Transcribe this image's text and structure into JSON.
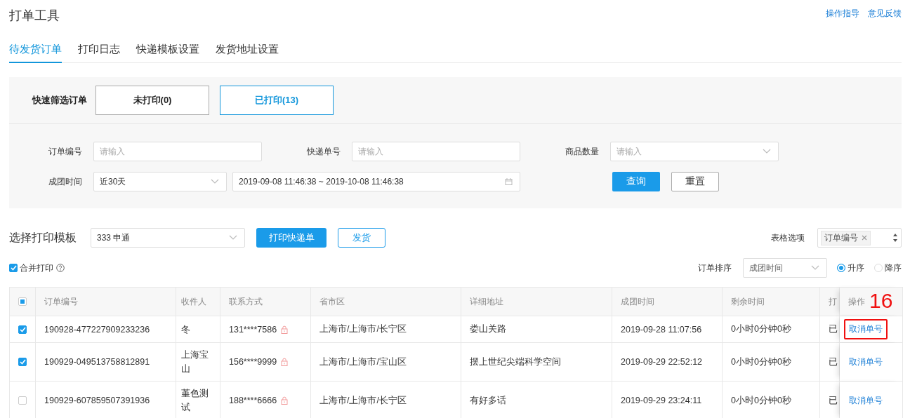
{
  "title": "打单工具",
  "header_links": [
    "操作指导",
    "意见反馈"
  ],
  "tabs": [
    {
      "label": "待发货订单",
      "selected": true
    },
    {
      "label": "打印日志",
      "selected": false
    },
    {
      "label": "快递模板设置",
      "selected": false
    },
    {
      "label": "发货地址设置",
      "selected": false
    }
  ],
  "quick_filter": {
    "label": "快速筛选订单",
    "options": [
      {
        "label": "未打印(0)",
        "selected": false
      },
      {
        "label": "已打印(13)",
        "selected": true
      }
    ]
  },
  "search_form": {
    "order_no": {
      "label": "订单编号",
      "placeholder": "请输入"
    },
    "tracking_no": {
      "label": "快递单号",
      "placeholder": "请输入"
    },
    "item_count": {
      "label": "商品数量",
      "placeholder": "请输入"
    },
    "group_time": {
      "label": "成团时间",
      "preset": "近30天",
      "range": "2019-09-08 11:46:38 ~ 2019-10-08 11:46:38"
    },
    "buttons": [
      {
        "label": "查询",
        "kind": "primary"
      },
      {
        "label": "重置",
        "kind": "default"
      }
    ]
  },
  "toolbar": {
    "template_label": "选择打印模板",
    "template_value": "333 申通",
    "buttons": [
      {
        "label": "打印快递单",
        "kind": "primary"
      },
      {
        "label": "发货",
        "kind": "outline"
      }
    ],
    "table_options_label": "表格选项",
    "table_options_tags": [
      "订单编号"
    ]
  },
  "merge_print": {
    "label": "合并打印",
    "checked": true
  },
  "sort": {
    "label": "订单排序",
    "value": "成团时间",
    "options": [
      {
        "label": "升序",
        "selected": true
      },
      {
        "label": "降序",
        "selected": false
      }
    ]
  },
  "table": {
    "select_all_indeterminate": true,
    "columns": [
      "订单编号",
      "收件人",
      "联系方式",
      "省市区",
      "详细地址",
      "成团时间",
      "剩余时间",
      "打",
      "操作"
    ],
    "rows": [
      {
        "selected": true,
        "highlighted": true,
        "order_no": "190928-477227909233236",
        "recipient": "冬",
        "phone": "131****7586",
        "region": "上海市/上海市/长宁区",
        "address": "娄山关路",
        "time": "2019-09-28 11:07:56",
        "remaining": "0小时0分钟0秒",
        "print": "已",
        "action": "取消单号"
      },
      {
        "selected": true,
        "highlighted": false,
        "order_no": "190929-049513758812891",
        "recipient": "上海宝山",
        "phone": "156****9999",
        "region": "上海市/上海市/宝山区",
        "address": "摆上世纪尖端科学空间",
        "time": "2019-09-29 22:52:12",
        "remaining": "0小时0分钟0秒",
        "print": "已",
        "action": "取消单号"
      },
      {
        "selected": false,
        "highlighted": false,
        "order_no": "190929-607859507391936",
        "recipient": "堇色测试",
        "phone": "188****6666",
        "region": "上海市/上海市/长宁区",
        "address": "有好多话",
        "time": "2019-09-29 23:24:11",
        "remaining": "0小时0分钟0秒",
        "print": "已",
        "action": "取消单号"
      }
    ]
  },
  "annotation": {
    "label": "16"
  }
}
